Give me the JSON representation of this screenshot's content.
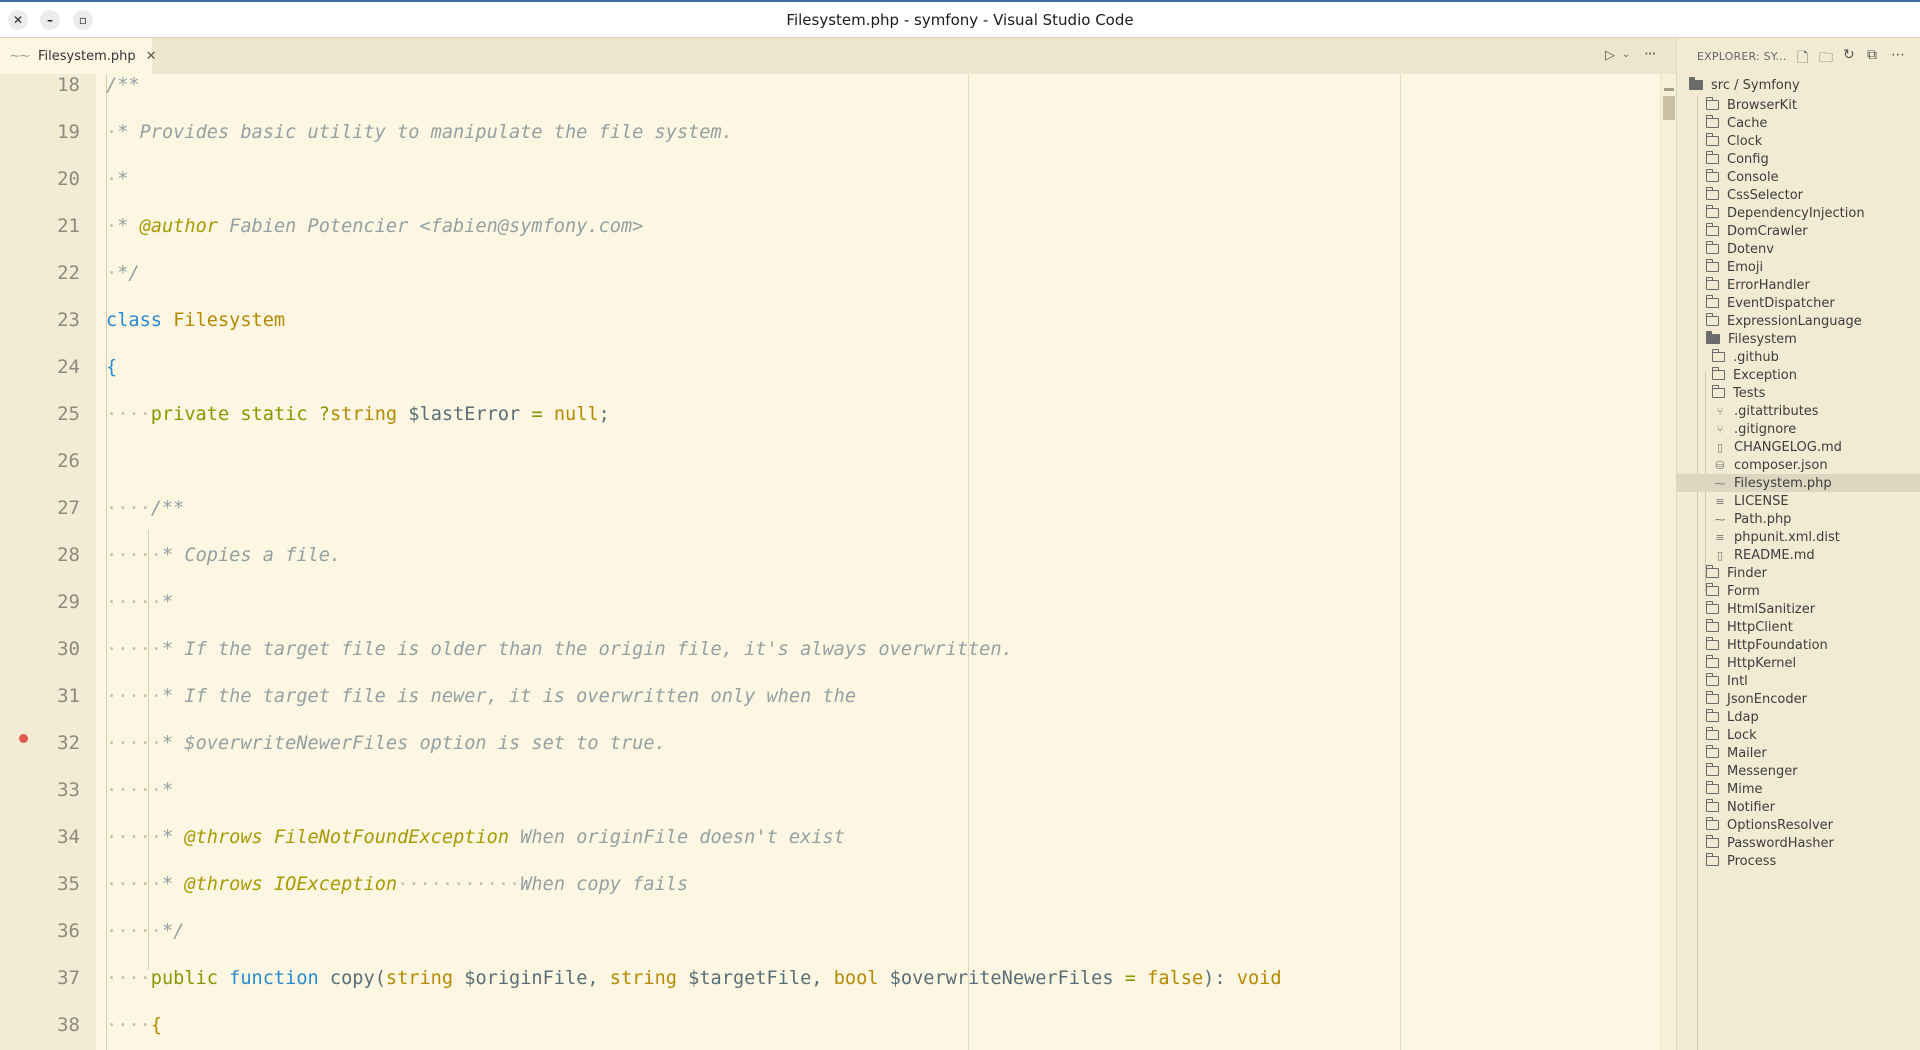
{
  "window": {
    "title": "Filesystem.php - symfony - Visual Studio Code",
    "close_glyph": "✕",
    "minimize_glyph": "–",
    "maximize_glyph": "▫"
  },
  "tabs": [
    {
      "label": "Filesystem.php",
      "icon": "php-file-icon",
      "close_glyph": "✕",
      "active": true
    }
  ],
  "editor_actions": {
    "run_glyph": "▷",
    "chevron_glyph": "⌄",
    "more_glyph": "···"
  },
  "editor": {
    "lines": [
      {
        "num": "18",
        "tokens": [
          [
            "c",
            "/**"
          ]
        ]
      },
      {
        "num": "19",
        "tokens": [
          [
            "ws",
            "·"
          ],
          [
            "c",
            "* Provides basic utility to manipulate the file system."
          ]
        ]
      },
      {
        "num": "20",
        "tokens": [
          [
            "ws",
            "·"
          ],
          [
            "c",
            "*"
          ]
        ]
      },
      {
        "num": "21",
        "tokens": [
          [
            "ws",
            "·"
          ],
          [
            "c",
            "* "
          ],
          [
            "tag",
            "@author"
          ],
          [
            "c",
            " Fabien Potencier <fabien@symfony.com>"
          ]
        ]
      },
      {
        "num": "22",
        "tokens": [
          [
            "ws",
            "·"
          ],
          [
            "c",
            "*/"
          ]
        ]
      },
      {
        "num": "23",
        "tokens": [
          [
            "kw",
            "class"
          ],
          [
            "vr",
            " "
          ],
          [
            "ty",
            "Filesystem"
          ]
        ]
      },
      {
        "num": "24",
        "tokens": [
          [
            "br",
            "{"
          ]
        ]
      },
      {
        "num": "25",
        "tokens": [
          [
            "ws",
            "····"
          ],
          [
            "op",
            "private"
          ],
          [
            "vr",
            " "
          ],
          [
            "op",
            "static"
          ],
          [
            "vr",
            " "
          ],
          [
            "op",
            "?"
          ],
          [
            "ty",
            "string"
          ],
          [
            "vr",
            " $lastError "
          ],
          [
            "op",
            "="
          ],
          [
            "vr",
            " "
          ],
          [
            "ty",
            "null"
          ],
          [
            "vr",
            ";"
          ]
        ]
      },
      {
        "num": "26",
        "tokens": []
      },
      {
        "num": "27",
        "tokens": [
          [
            "ws",
            "····"
          ],
          [
            "c",
            "/**"
          ]
        ]
      },
      {
        "num": "28",
        "tokens": [
          [
            "ws",
            "·····"
          ],
          [
            "c",
            "* Copies a file."
          ]
        ]
      },
      {
        "num": "29",
        "tokens": [
          [
            "ws",
            "·····"
          ],
          [
            "c",
            "*"
          ]
        ]
      },
      {
        "num": "30",
        "tokens": [
          [
            "ws",
            "·····"
          ],
          [
            "c",
            "* If the target file is older than the origin file, it's always overwritten."
          ]
        ]
      },
      {
        "num": "31",
        "tokens": [
          [
            "ws",
            "·····"
          ],
          [
            "c",
            "* If the target file is newer, it is overwritten only when the"
          ]
        ]
      },
      {
        "num": "32",
        "tokens": [
          [
            "ws",
            "·····"
          ],
          [
            "c",
            "* $overwriteNewerFiles option is set to true."
          ]
        ],
        "breakpoint": true
      },
      {
        "num": "33",
        "tokens": [
          [
            "ws",
            "·····"
          ],
          [
            "c",
            "*"
          ]
        ]
      },
      {
        "num": "34",
        "tokens": [
          [
            "ws",
            "·····"
          ],
          [
            "c",
            "* "
          ],
          [
            "tag",
            "@throws"
          ],
          [
            "c",
            " "
          ],
          [
            "tag",
            "FileNotFoundException"
          ],
          [
            "c",
            " When originFile doesn't exist"
          ]
        ]
      },
      {
        "num": "35",
        "tokens": [
          [
            "ws",
            "·····"
          ],
          [
            "c",
            "* "
          ],
          [
            "tag",
            "@throws"
          ],
          [
            "c",
            " "
          ],
          [
            "tag",
            "IOException"
          ],
          [
            "ws",
            "···········"
          ],
          [
            "c",
            "When copy fails"
          ]
        ]
      },
      {
        "num": "36",
        "tokens": [
          [
            "ws",
            "·····"
          ],
          [
            "c",
            "*/"
          ]
        ]
      },
      {
        "num": "37",
        "tokens": [
          [
            "ws",
            "····"
          ],
          [
            "op",
            "public"
          ],
          [
            "vr",
            " "
          ],
          [
            "kw",
            "function"
          ],
          [
            "vr",
            " copy("
          ],
          [
            "ty",
            "string"
          ],
          [
            "vr",
            " $originFile, "
          ],
          [
            "ty",
            "string"
          ],
          [
            "vr",
            " $targetFile, "
          ],
          [
            "ty",
            "bool"
          ],
          [
            "vr",
            " $overwriteNewerFiles "
          ],
          [
            "op",
            "="
          ],
          [
            "vr",
            " "
          ],
          [
            "ty",
            "false"
          ],
          [
            "vr",
            "): "
          ],
          [
            "ty",
            "void"
          ]
        ]
      },
      {
        "num": "38",
        "tokens": [
          [
            "ws",
            "····"
          ],
          [
            "ty",
            "{"
          ]
        ]
      }
    ]
  },
  "explorer": {
    "title": "EXPLORER: SY...",
    "header_icons": [
      "new-file-icon",
      "new-folder-icon",
      "refresh-icon",
      "collapse-all-icon",
      "more-icon"
    ],
    "root": "src / Symfony",
    "items": [
      {
        "label": "BrowserKit",
        "kind": "folder",
        "depth": 1
      },
      {
        "label": "Cache",
        "kind": "folder",
        "depth": 1
      },
      {
        "label": "Clock",
        "kind": "folder",
        "depth": 1
      },
      {
        "label": "Config",
        "kind": "folder",
        "depth": 1
      },
      {
        "label": "Console",
        "kind": "folder",
        "depth": 1
      },
      {
        "label": "CssSelector",
        "kind": "folder",
        "depth": 1
      },
      {
        "label": "DependencyInjection",
        "kind": "folder",
        "depth": 1
      },
      {
        "label": "DomCrawler",
        "kind": "folder",
        "depth": 1
      },
      {
        "label": "Dotenv",
        "kind": "folder",
        "depth": 1
      },
      {
        "label": "Emoji",
        "kind": "folder",
        "depth": 1
      },
      {
        "label": "ErrorHandler",
        "kind": "folder",
        "depth": 1
      },
      {
        "label": "EventDispatcher",
        "kind": "folder",
        "depth": 1
      },
      {
        "label": "ExpressionLanguage",
        "kind": "folder",
        "depth": 1
      },
      {
        "label": "Filesystem",
        "kind": "folder-open",
        "depth": 1
      },
      {
        "label": ".github",
        "kind": "folder",
        "depth": 2
      },
      {
        "label": "Exception",
        "kind": "folder",
        "depth": 2
      },
      {
        "label": "Tests",
        "kind": "folder",
        "depth": 2
      },
      {
        "label": ".gitattributes",
        "kind": "git",
        "depth": 2
      },
      {
        "label": ".gitignore",
        "kind": "git",
        "depth": 2
      },
      {
        "label": "CHANGELOG.md",
        "kind": "book",
        "depth": 2
      },
      {
        "label": "composer.json",
        "kind": "db",
        "depth": 2
      },
      {
        "label": "Filesystem.php",
        "kind": "php",
        "depth": 2,
        "selected": true
      },
      {
        "label": "LICENSE",
        "kind": "text",
        "depth": 2
      },
      {
        "label": "Path.php",
        "kind": "php",
        "depth": 2
      },
      {
        "label": "phpunit.xml.dist",
        "kind": "text",
        "depth": 2
      },
      {
        "label": "README.md",
        "kind": "book",
        "depth": 2
      },
      {
        "label": "Finder",
        "kind": "folder",
        "depth": 1
      },
      {
        "label": "Form",
        "kind": "folder",
        "depth": 1
      },
      {
        "label": "HtmlSanitizer",
        "kind": "folder",
        "depth": 1
      },
      {
        "label": "HttpClient",
        "kind": "folder",
        "depth": 1
      },
      {
        "label": "HttpFoundation",
        "kind": "folder",
        "depth": 1
      },
      {
        "label": "HttpKernel",
        "kind": "folder",
        "depth": 1
      },
      {
        "label": "Intl",
        "kind": "folder",
        "depth": 1
      },
      {
        "label": "JsonEncoder",
        "kind": "folder",
        "depth": 1
      },
      {
        "label": "Ldap",
        "kind": "folder",
        "depth": 1
      },
      {
        "label": "Lock",
        "kind": "folder",
        "depth": 1
      },
      {
        "label": "Mailer",
        "kind": "folder",
        "depth": 1
      },
      {
        "label": "Messenger",
        "kind": "folder",
        "depth": 1
      },
      {
        "label": "Mime",
        "kind": "folder",
        "depth": 1
      },
      {
        "label": "Notifier",
        "kind": "folder",
        "depth": 1
      },
      {
        "label": "OptionsResolver",
        "kind": "folder",
        "depth": 1
      },
      {
        "label": "PasswordHasher",
        "kind": "folder",
        "depth": 1
      },
      {
        "label": "Process",
        "kind": "folder",
        "depth": 1
      }
    ]
  },
  "theme": {
    "editor_bg": "#fdf6e3",
    "keyword": "#268bd2",
    "type": "#b58900",
    "comment": "#93a1a1",
    "breakpoint": "#e05a4f"
  }
}
